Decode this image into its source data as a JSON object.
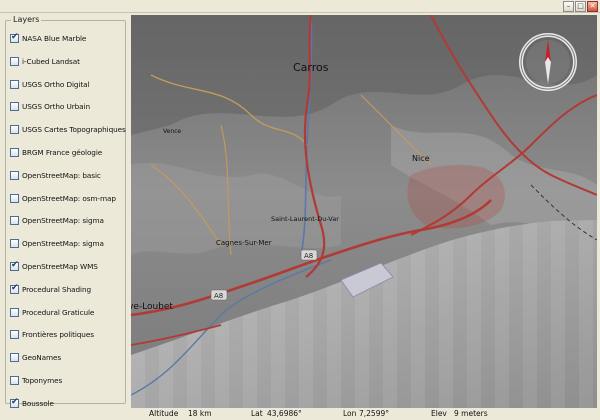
{
  "window": {
    "buttons": [
      "minimize-button",
      "maximize-button",
      "close-button"
    ]
  },
  "layers_panel": {
    "title": "Layers",
    "items": [
      {
        "label": "NASA Blue Marble",
        "checked": true
      },
      {
        "label": "i-Cubed Landsat",
        "checked": false
      },
      {
        "label": "USGS Ortho Digital",
        "checked": false
      },
      {
        "label": "USGS Ortho Urbain",
        "checked": false
      },
      {
        "label": "USGS Cartes Topographiques",
        "checked": false
      },
      {
        "label": "BRGM France géologie",
        "checked": false
      },
      {
        "label": "OpenStreetMap: basic",
        "checked": false
      },
      {
        "label": "OpenStreetMap: osm-map",
        "checked": false
      },
      {
        "label": "OpenStreetMap: sigma",
        "checked": false
      },
      {
        "label": "OpenStreetMap: sigma",
        "checked": false
      },
      {
        "label": "OpenStreetMap WMS",
        "checked": true
      },
      {
        "label": "Procedural Shading",
        "checked": true
      },
      {
        "label": "Procedural Graticule",
        "checked": false
      },
      {
        "label": "Frontières politiques",
        "checked": false
      },
      {
        "label": "GeoNames",
        "checked": false
      },
      {
        "label": "Toponymes",
        "checked": false
      },
      {
        "label": "Boussole",
        "checked": true
      }
    ]
  },
  "map": {
    "labels": {
      "carros": "Carros",
      "nice": "Nice",
      "vence": "Vence",
      "saint_laurent": "Saint-Laurent-Du-Var",
      "cagnes": "Cagnes-Sur-Mer",
      "villeneuve": "ve-Loubet",
      "a8_a": "A8",
      "a8_b": "A8"
    },
    "colors": {
      "road": "#b23a35",
      "secondary": "#c59a5c",
      "river": "#5a78a8",
      "sea": "#9a9a9a"
    }
  },
  "status": {
    "altitude_label": "Altitude",
    "altitude_value": "18 km",
    "lat_label": "Lat",
    "lat_value": "43,6986°",
    "lon_label": "Lon",
    "lon_value": "7,2599°",
    "elev_label": "Elev",
    "elev_value": "9 meters"
  }
}
